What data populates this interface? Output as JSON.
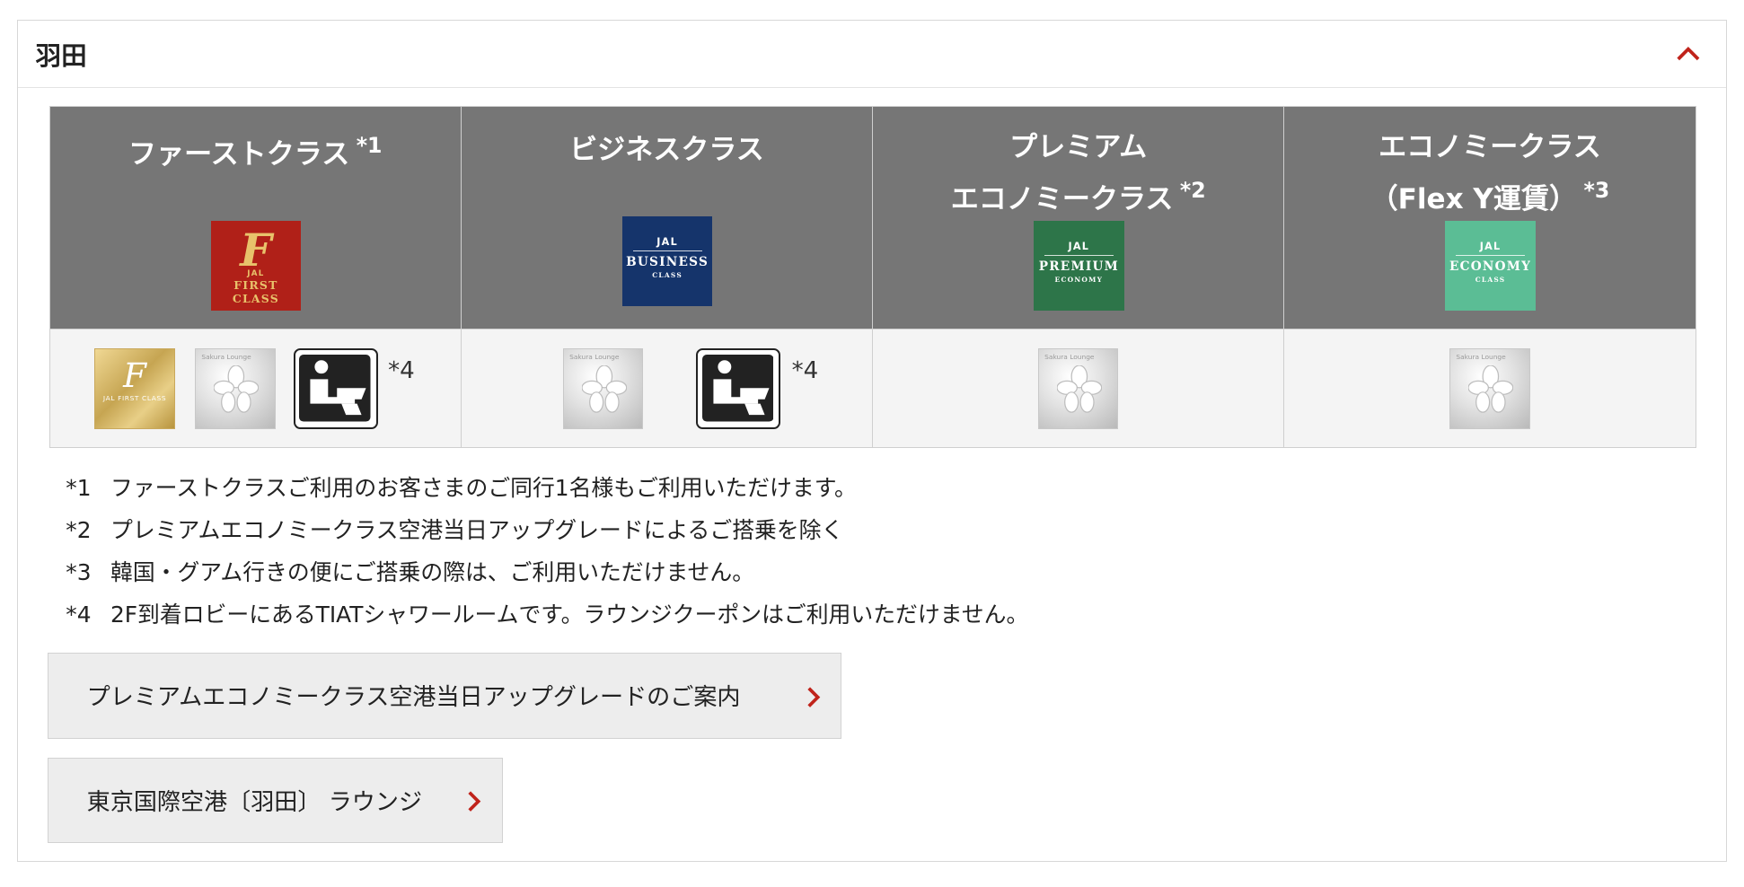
{
  "section": {
    "title": "羽田"
  },
  "columns": [
    {
      "title_line1": "ファーストクラス",
      "title_line2": "",
      "mark": "*1",
      "logo": {
        "name": "JAL FIRST CLASS",
        "jal": "JAL",
        "big": "First Class",
        "small": "",
        "script": "F",
        "color": "#b02018"
      }
    },
    {
      "title_line1": "ビジネスクラス",
      "title_line2": "",
      "mark": "",
      "logo": {
        "name": "JAL BUSINESS CLASS",
        "jal": "JAL",
        "big": "Business",
        "small": "Class",
        "color": "#15346b"
      }
    },
    {
      "title_line1": "プレミアム",
      "title_line2": "エコノミークラス",
      "mark": "*2",
      "logo": {
        "name": "JAL PREMIUM ECONOMY",
        "jal": "JAL",
        "big": "Premium",
        "small": "Economy",
        "color": "#2d7549"
      }
    },
    {
      "title_line1": "エコノミークラス",
      "title_line2": "（Flex Y運賃）",
      "mark": "*3",
      "logo": {
        "name": "JAL ECONOMY CLASS",
        "jal": "JAL",
        "big": "Economy",
        "small": "Class",
        "color": "#5bbd95"
      }
    }
  ],
  "lounge_icons": {
    "first_lounge": {
      "letter": "F",
      "text": "JAL FIRST CLASS"
    },
    "sakura_lounge": {
      "text": "Sakura Lounge"
    },
    "shower_note": "*4"
  },
  "notes": [
    {
      "key": "*1",
      "text": "ファーストクラスご利用のお客さまのご同行1名様もご利用いただけます。"
    },
    {
      "key": "*2",
      "text": "プレミアムエコノミークラス空港当日アップグレードによるご搭乗を除く"
    },
    {
      "key": "*3",
      "text": "韓国・グアム行きの便にご搭乗の際は、ご利用いただけません。"
    },
    {
      "key": "*4",
      "text": "2F到着ロビーにあるTIATシャワールームです。ラウンジクーポンはご利用いただけません。"
    }
  ],
  "links": [
    {
      "label": "プレミアムエコノミークラス空港当日アップグレードのご案内"
    },
    {
      "label": "東京国際空港〔羽田〕 ラウンジ"
    }
  ],
  "colors": {
    "header_gray": "#767676",
    "accent_red": "#c0231b",
    "cell_bg": "#f4f4f4",
    "button_bg": "#ededed"
  }
}
